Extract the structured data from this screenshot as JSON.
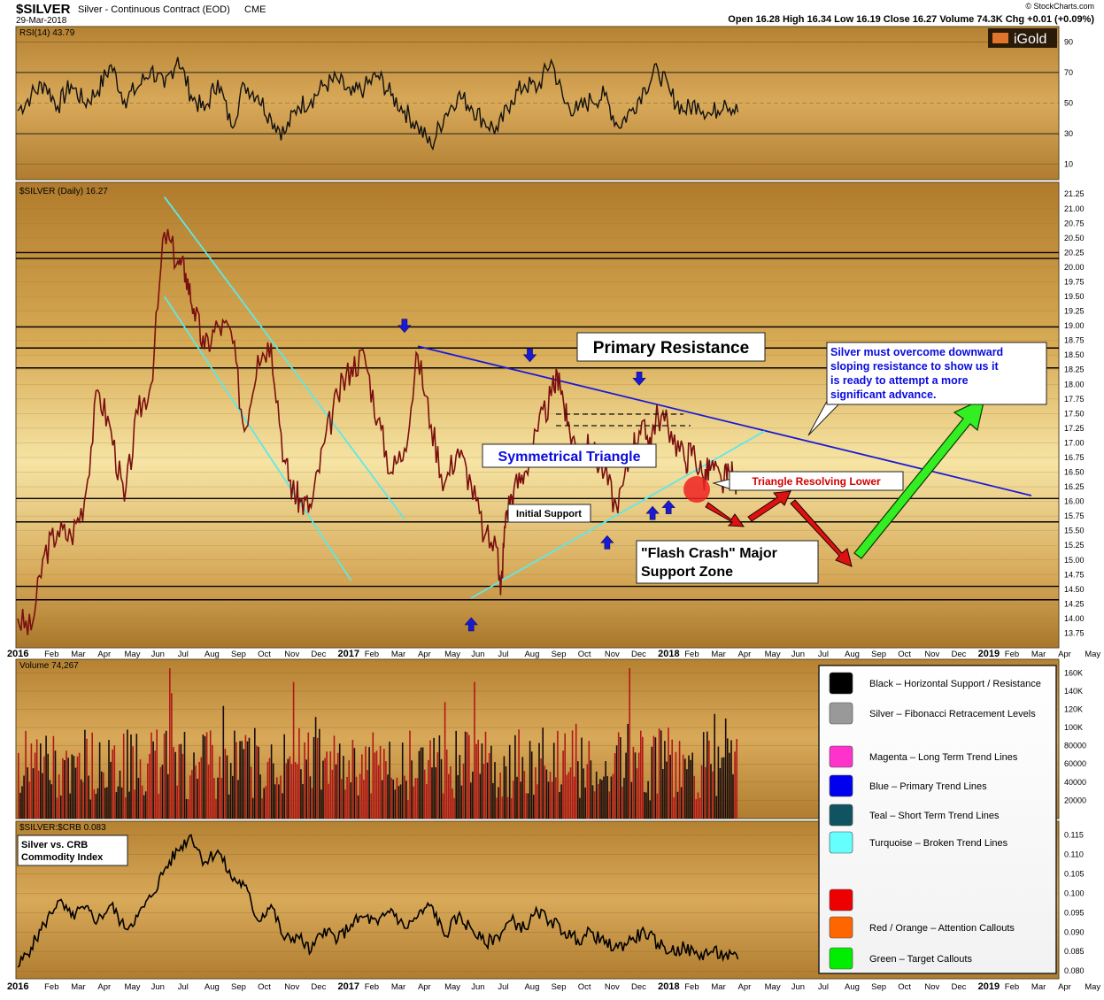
{
  "header": {
    "symbol": "$SILVER",
    "name": "Silver - Continuous Contract (EOD)",
    "exchange": "CME",
    "date": "29-Mar-2018",
    "copyright": "© StockCharts.com",
    "quote": "Open 16.28  High 16.34  Low 16.19  Close 16.27  Volume 74.3K  Chg +0.01 (+0.09%)",
    "logo_text": "iGold"
  },
  "rsi_panel": {
    "label": "RSI(14) 43.79",
    "ticks": [
      90,
      70,
      50,
      30,
      10
    ],
    "overbought": 70,
    "oversold": 30
  },
  "price_panel": {
    "label": "$SILVER (Daily) 16.27",
    "ylim": [
      13.5,
      21.45
    ],
    "ticks": [
      21.25,
      21.0,
      20.75,
      20.5,
      20.25,
      20.0,
      19.75,
      19.5,
      19.25,
      19.0,
      18.75,
      18.5,
      18.25,
      18.0,
      17.75,
      17.5,
      17.25,
      17.0,
      16.75,
      16.5,
      16.25,
      16.0,
      15.75,
      15.5,
      15.25,
      15.0,
      14.75,
      14.5,
      14.25,
      14.0,
      13.75
    ],
    "support_resistance_levels": [
      20.25,
      20.15,
      18.98,
      18.62,
      18.28,
      16.05,
      15.65,
      14.55,
      14.32
    ],
    "annotations": {
      "primary_resistance": "Primary Resistance",
      "symmetrical_triangle": "Symmetrical Triangle",
      "initial_support": "Initial Support",
      "flash_crash_line1": "\"Flash Crash\" Major",
      "flash_crash_line2": "Support Zone",
      "triangle_resolving": "Triangle Resolving Lower",
      "callout_line1": "Silver must overcome downward",
      "callout_line2": "sloping resistance to show us it",
      "callout_line3": "is ready to attempt a more",
      "callout_line4": "significant advance."
    }
  },
  "x_axis": {
    "labels": [
      {
        "text": "2016",
        "bold": true
      },
      {
        "text": "Feb"
      },
      {
        "text": "Mar"
      },
      {
        "text": "Apr"
      },
      {
        "text": "May"
      },
      {
        "text": "Jun"
      },
      {
        "text": "Jul"
      },
      {
        "text": "Aug"
      },
      {
        "text": "Sep"
      },
      {
        "text": "Oct"
      },
      {
        "text": "Nov"
      },
      {
        "text": "Dec"
      },
      {
        "text": "2017",
        "bold": true
      },
      {
        "text": "Feb"
      },
      {
        "text": "Mar"
      },
      {
        "text": "Apr"
      },
      {
        "text": "May"
      },
      {
        "text": "Jun"
      },
      {
        "text": "Jul"
      },
      {
        "text": "Aug"
      },
      {
        "text": "Sep"
      },
      {
        "text": "Oct"
      },
      {
        "text": "Nov"
      },
      {
        "text": "Dec"
      },
      {
        "text": "2018",
        "bold": true
      },
      {
        "text": "Feb"
      },
      {
        "text": "Mar"
      },
      {
        "text": "Apr"
      },
      {
        "text": "May"
      },
      {
        "text": "Jun"
      },
      {
        "text": "Jul"
      },
      {
        "text": "Aug"
      },
      {
        "text": "Sep"
      },
      {
        "text": "Oct"
      },
      {
        "text": "Nov"
      },
      {
        "text": "Dec"
      },
      {
        "text": "2019",
        "bold": true
      },
      {
        "text": "Feb"
      },
      {
        "text": "Mar"
      },
      {
        "text": "Apr"
      },
      {
        "text": "May"
      }
    ]
  },
  "volume_panel": {
    "label": "Volume 74,267",
    "ticks": [
      "160K",
      "140K",
      "120K",
      "100K",
      "80000",
      "60000",
      "40000",
      "20000"
    ]
  },
  "ratio_panel": {
    "label": "$SILVER:$CRB 0.083",
    "box_line1": "Silver vs. CRB",
    "box_line2": "Commodity Index",
    "ticks": [
      "0.115",
      "0.110",
      "0.105",
      "0.100",
      "0.095",
      "0.090",
      "0.085",
      "0.080"
    ]
  },
  "legend": [
    {
      "color": "#000000",
      "text": "Black – Horizontal Support / Resistance"
    },
    {
      "color": "#999999",
      "text": "Silver – Fibonacci Retracement Levels"
    },
    {
      "color": "#ff33cc",
      "text": "Magenta – Long Term Trend Lines"
    },
    {
      "color": "#0000ee",
      "text": "Blue – Primary Trend Lines"
    },
    {
      "color": "#0f5460",
      "text": "Teal – Short Term Trend Lines"
    },
    {
      "color": "#66ffff",
      "text": "Turquoise – Broken Trend Lines"
    },
    {
      "color": "#ee0000",
      "text": ""
    },
    {
      "color": "#ff6600",
      "text": "Red / Orange – Attention Callouts"
    },
    {
      "color": "#00ee00",
      "text": "Green – Target Callouts"
    }
  ],
  "chart_data": {
    "type": "line",
    "title": "$SILVER Silver - Continuous Contract (EOD) CME",
    "x_unit": "months since Jan 2016",
    "close_series": {
      "name": "$SILVER (Daily)",
      "x": [
        0.0,
        0.5,
        1.0,
        1.5,
        2.0,
        2.5,
        3.0,
        3.5,
        4.0,
        4.5,
        5.0,
        5.5,
        6.0,
        6.3,
        6.6,
        7.0,
        7.5,
        8.0,
        8.5,
        9.0,
        9.5,
        10.0,
        10.3,
        10.6,
        11.0,
        11.5,
        12.0,
        12.5,
        13.0,
        13.5,
        14.0,
        14.5,
        15.0,
        15.5,
        16.0,
        16.5,
        17.0,
        17.5,
        18.0,
        18.1,
        18.3,
        18.6,
        19.0,
        19.5,
        20.0,
        20.3,
        20.6,
        21.0,
        21.5,
        22.0,
        22.5,
        23.0,
        23.3,
        23.7,
        24.0,
        24.5,
        25.0,
        25.3,
        25.7,
        26.0,
        26.4,
        26.7,
        27.0
      ],
      "y": [
        14.0,
        13.8,
        15.1,
        15.5,
        15.4,
        16.0,
        17.9,
        17.2,
        16.0,
        17.5,
        18.0,
        20.6,
        20.1,
        19.9,
        19.3,
        18.6,
        19.0,
        18.9,
        17.2,
        18.5,
        18.7,
        16.7,
        16.2,
        16.0,
        15.9,
        17.0,
        17.8,
        18.3,
        18.5,
        17.4,
        16.5,
        16.9,
        18.5,
        17.3,
        16.3,
        16.9,
        16.3,
        15.4,
        15.2,
        14.4,
        15.8,
        16.2,
        16.5,
        17.2,
        17.8,
        18.2,
        17.3,
        16.9,
        16.9,
        16.5,
        15.8,
        16.9,
        17.2,
        17.1,
        17.5,
        17.2,
        16.7,
        16.9,
        16.4,
        16.6,
        16.3,
        16.5,
        16.27
      ]
    },
    "rsi_series": {
      "name": "RSI(14)",
      "x": [
        0.0,
        0.5,
        1.0,
        1.5,
        2.0,
        2.5,
        3.0,
        3.5,
        4.0,
        4.5,
        5.0,
        5.5,
        6.0,
        6.5,
        7.0,
        7.5,
        8.0,
        8.5,
        9.0,
        9.5,
        10.0,
        10.5,
        11.0,
        11.5,
        12.0,
        12.5,
        13.0,
        13.5,
        14.0,
        14.5,
        15.0,
        15.5,
        16.0,
        16.5,
        17.0,
        17.5,
        18.0,
        18.5,
        19.0,
        19.5,
        20.0,
        20.5,
        21.0,
        21.5,
        22.0,
        22.5,
        23.0,
        23.5,
        24.0,
        24.5,
        25.0,
        25.5,
        26.0,
        26.5,
        27.0
      ],
      "y": [
        45,
        55,
        63,
        48,
        62,
        50,
        58,
        75,
        52,
        60,
        72,
        60,
        80,
        55,
        45,
        65,
        35,
        62,
        55,
        40,
        30,
        48,
        52,
        62,
        65,
        55,
        60,
        68,
        55,
        45,
        35,
        22,
        42,
        55,
        48,
        38,
        32,
        52,
        62,
        60,
        78,
        50,
        45,
        52,
        55,
        35,
        45,
        60,
        72,
        55,
        45,
        50,
        42,
        52,
        44
      ]
    },
    "ratio_series": {
      "name": "$SILVER:$CRB",
      "x": [
        0.0,
        0.5,
        1.0,
        1.5,
        2.0,
        2.5,
        3.0,
        3.5,
        4.0,
        4.5,
        5.0,
        5.5,
        6.0,
        6.5,
        7.0,
        7.5,
        8.0,
        8.5,
        9.0,
        9.5,
        10.0,
        10.5,
        11.0,
        11.5,
        12.0,
        12.5,
        13.0,
        13.5,
        14.0,
        14.5,
        15.0,
        15.5,
        16.0,
        16.5,
        17.0,
        17.5,
        18.0,
        18.5,
        19.0,
        19.5,
        20.0,
        20.5,
        21.0,
        21.5,
        22.0,
        22.5,
        23.0,
        23.5,
        24.0,
        24.5,
        25.0,
        25.5,
        26.0,
        26.5,
        27.0
      ],
      "y": [
        0.081,
        0.086,
        0.092,
        0.098,
        0.094,
        0.096,
        0.093,
        0.097,
        0.091,
        0.094,
        0.099,
        0.106,
        0.111,
        0.115,
        0.108,
        0.111,
        0.104,
        0.102,
        0.093,
        0.097,
        0.088,
        0.089,
        0.085,
        0.091,
        0.088,
        0.092,
        0.094,
        0.092,
        0.096,
        0.091,
        0.094,
        0.097,
        0.089,
        0.094,
        0.091,
        0.087,
        0.089,
        0.093,
        0.091,
        0.095,
        0.093,
        0.09,
        0.088,
        0.09,
        0.087,
        0.086,
        0.088,
        0.09,
        0.087,
        0.085,
        0.086,
        0.084,
        0.085,
        0.084,
        0.083
      ]
    },
    "volume": {
      "name": "Volume",
      "unit": "contracts",
      "typical_range": [
        20000,
        100000
      ],
      "spikes": [
        {
          "x": 5.7,
          "value": 165000
        },
        {
          "x": 10.3,
          "value": 150000
        },
        {
          "x": 17.1,
          "value": 150000
        },
        {
          "x": 22.9,
          "value": 165000
        }
      ]
    },
    "trend_lines": [
      {
        "name": "Primary Resistance",
        "color": "#1a1ad6",
        "from": [
          15.0,
          18.65
        ],
        "to": [
          38.0,
          16.1
        ]
      },
      {
        "name": "Triangle Support",
        "color": "#5ee8e8",
        "from": [
          17.0,
          14.35
        ],
        "to": [
          28.0,
          17.2
        ]
      },
      {
        "name": "Channel Upper",
        "color": "#5ee8e8",
        "from": [
          5.5,
          21.2
        ],
        "to": [
          14.5,
          15.7
        ]
      },
      {
        "name": "Channel Lower",
        "color": "#5ee8e8",
        "from": [
          5.5,
          19.5
        ],
        "to": [
          12.5,
          14.65
        ]
      }
    ],
    "blue_arrows_down": [
      [
        14.5,
        18.9
      ],
      [
        19.2,
        18.4
      ],
      [
        23.3,
        18.0
      ]
    ],
    "blue_arrows_up": [
      [
        17.0,
        14.0
      ],
      [
        22.1,
        15.4
      ],
      [
        23.8,
        15.9
      ],
      [
        24.4,
        16.0
      ]
    ],
    "xlim": [
      0,
      38.5
    ]
  }
}
